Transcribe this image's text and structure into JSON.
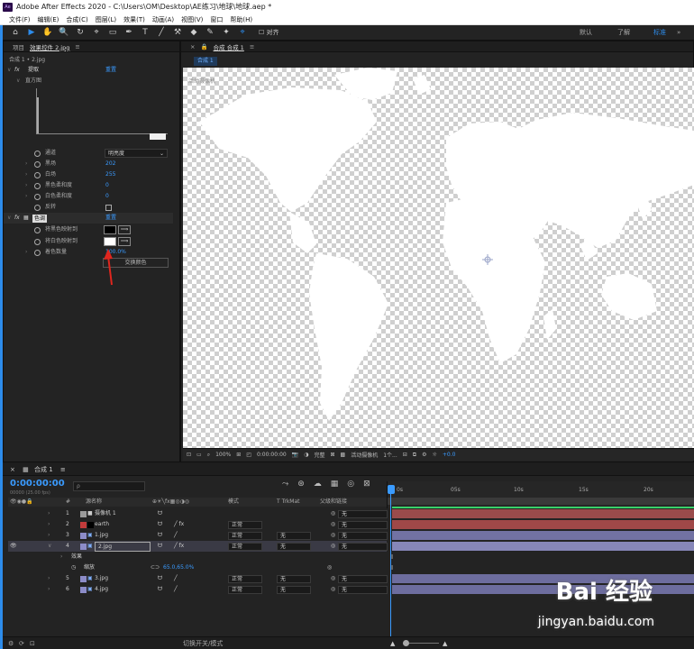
{
  "window": {
    "title": "Adobe After Effects 2020 - C:\\Users\\OM\\Desktop\\AE练习\\地球\\地球.aep *",
    "logo_text": "Ae"
  },
  "menu": [
    "文件(F)",
    "编辑(E)",
    "合成(C)",
    "图层(L)",
    "效果(T)",
    "动画(A)",
    "视图(V)",
    "窗口",
    "帮助(H)"
  ],
  "toolbar": {
    "tools": [
      "⌂",
      "▶",
      "✋",
      "🔍",
      "↻",
      "⌖",
      "▭",
      "✒",
      "T",
      "╱",
      "⚒",
      "◆",
      "✎",
      "✦",
      "⌖"
    ],
    "snap_label": "对齐",
    "workspaces": [
      {
        "label": "默认",
        "active": false
      },
      {
        "label": "了解",
        "active": false
      },
      {
        "label": "标准",
        "active": true
      }
    ]
  },
  "effects_panel": {
    "tabs": [
      "项目",
      "效果控件 2.jpg"
    ],
    "breadcrumb": "合成 1 • 2.jpg",
    "effect1": {
      "name": "提取",
      "reset": "重置",
      "histogram_label": "直方图"
    },
    "channel": {
      "label": "通道",
      "value": "明亮度"
    },
    "params": [
      {
        "label": "黑场",
        "value": "202"
      },
      {
        "label": "白场",
        "value": "255"
      },
      {
        "label": "黑色柔和度",
        "value": "0"
      },
      {
        "label": "白色柔和度",
        "value": "0"
      },
      {
        "label": "反转",
        "value": ""
      }
    ],
    "effect2": {
      "name": "色调",
      "reset": "重置"
    },
    "tint_rows": [
      {
        "label": "将黑色映射到"
      },
      {
        "label": "将白色映射到"
      },
      {
        "label": "着色数量",
        "value": "100.0%"
      }
    ],
    "swap_button": "交换颜色"
  },
  "comp_panel": {
    "tab_title": "合成 合成 1",
    "chip": "合成 1",
    "canvas_label": "活动摄像机",
    "viewer": {
      "zoom": "100%",
      "time": "0:00:00:00",
      "quality": "完整",
      "camera": "活动摄像机",
      "views": "1个...",
      "offset": "+0.0"
    }
  },
  "timeline": {
    "tab": "合成 1",
    "timecode": "0:00:00:00",
    "fps": "00000 (25.00 fps)",
    "search_placeholder": "ρ",
    "headers": {
      "num": "#",
      "source": "源名称",
      "mode": "模式",
      "trk": "T TrkMat",
      "parent": "父级和链接"
    },
    "ruler": [
      "0s",
      "05s",
      "10s",
      "15s",
      "20s"
    ],
    "layers": [
      {
        "num": "1",
        "name": "摄像机 1",
        "mode": "",
        "trk": "",
        "parent": "无",
        "color": "#9b9b9b",
        "bar": "#9a4b4b"
      },
      {
        "num": "2",
        "name": "earth",
        "mode": "正常",
        "trk": "",
        "parent": "无",
        "color": "#c23b3b",
        "bar": "#a04848"
      },
      {
        "num": "3",
        "name": "1.jpg",
        "mode": "正常",
        "trk": "无",
        "parent": "无",
        "color": "#8c8cc8",
        "bar": "#7272a3"
      },
      {
        "num": "4",
        "name": "2.jpg",
        "mode": "正常",
        "trk": "无",
        "parent": "无",
        "color": "#8c8cc8",
        "bar": "#8686b8"
      },
      {
        "num": "5",
        "name": "3.jpg",
        "mode": "正常",
        "trk": "无",
        "parent": "无",
        "color": "#8c8cc8",
        "bar": "#6d6d9e"
      },
      {
        "num": "6",
        "name": "4.jpg",
        "mode": "正常",
        "trk": "无",
        "parent": "无",
        "color": "#8c8cc8",
        "bar": "#6d6d9e"
      }
    ],
    "effects_sub": "效果",
    "scale_label": "缩放",
    "scale_value": "65.0,65.0%",
    "status_icons": [
      "⚙",
      "⟳",
      "⊡"
    ],
    "footer_toggle": "切换开关/模式"
  },
  "watermark": {
    "main": "Bai 经验",
    "sub": "jingyan.baidu.com"
  },
  "colors": {
    "accent": "#2d8ceb",
    "value_blue": "#3a9bff"
  }
}
